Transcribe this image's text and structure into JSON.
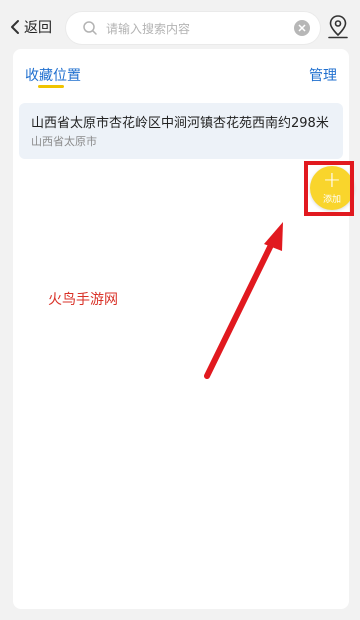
{
  "header": {
    "back_label": "返回",
    "search_placeholder": "请输入搜索内容"
  },
  "card": {
    "tab_title": "收藏位置",
    "manage_label": "管理",
    "items": [
      {
        "title": "山西省太原市杏花岭区中涧河镇杏花苑西南约298米",
        "subtitle": "山西省太原市"
      }
    ]
  },
  "fab": {
    "icon": "plus-icon",
    "label": "添加"
  },
  "watermark": "火鸟手游网",
  "colors": {
    "accent": "#1f6fcf",
    "fab": "#f9d52c",
    "highlight": "#e1191f",
    "underline": "#f0c400"
  }
}
